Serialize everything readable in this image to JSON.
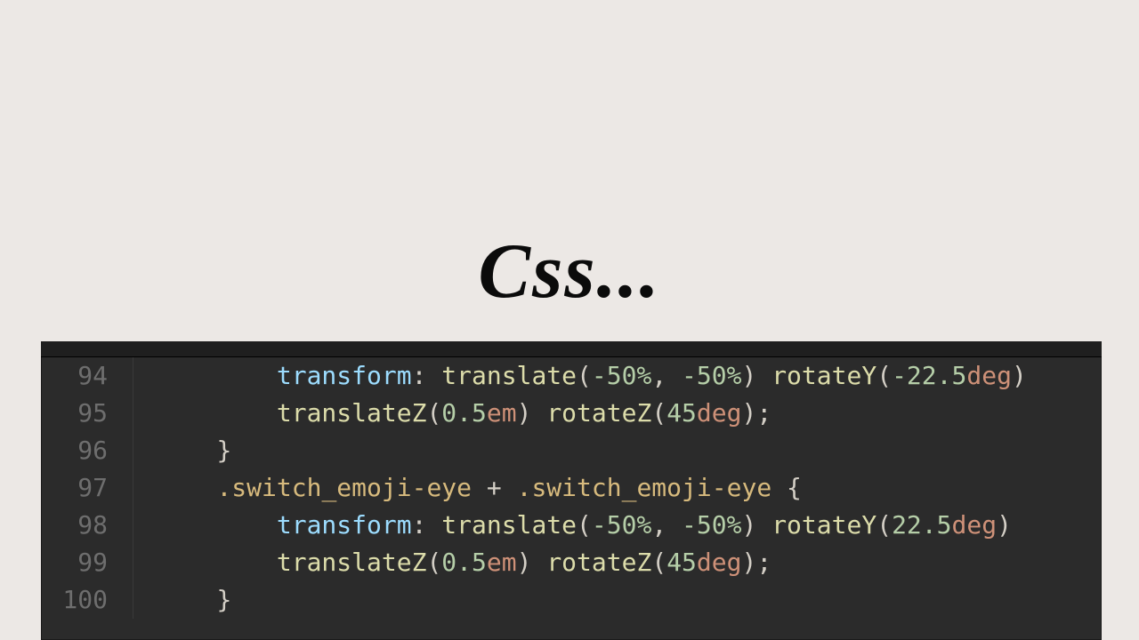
{
  "title": "Css...",
  "editor": {
    "startLine": 94,
    "lines": [
      {
        "n": 94,
        "indent": 2,
        "tokens": [
          {
            "t": "transform",
            "c": "tok-prop"
          },
          {
            "t": ": ",
            "c": "tok-punc"
          },
          {
            "t": "translate",
            "c": "tok-func"
          },
          {
            "t": "(",
            "c": "tok-punc"
          },
          {
            "t": "-50%",
            "c": "tok-num"
          },
          {
            "t": ", ",
            "c": "tok-punc"
          },
          {
            "t": "-50%",
            "c": "tok-num"
          },
          {
            "t": ") ",
            "c": "tok-punc"
          },
          {
            "t": "rotateY",
            "c": "tok-func"
          },
          {
            "t": "(",
            "c": "tok-punc"
          },
          {
            "t": "-22.5",
            "c": "tok-num"
          },
          {
            "t": "deg",
            "c": "tok-deg"
          },
          {
            "t": ")",
            "c": "tok-punc"
          }
        ]
      },
      {
        "n": 95,
        "indent": 2,
        "tokens": [
          {
            "t": "translateZ",
            "c": "tok-func"
          },
          {
            "t": "(",
            "c": "tok-punc"
          },
          {
            "t": "0.5",
            "c": "tok-num"
          },
          {
            "t": "em",
            "c": "tok-deg"
          },
          {
            "t": ") ",
            "c": "tok-punc"
          },
          {
            "t": "rotateZ",
            "c": "tok-func"
          },
          {
            "t": "(",
            "c": "tok-punc"
          },
          {
            "t": "45",
            "c": "tok-num"
          },
          {
            "t": "deg",
            "c": "tok-deg"
          },
          {
            "t": ")",
            "c": "tok-punc"
          },
          {
            "t": ";",
            "c": "tok-punc"
          }
        ]
      },
      {
        "n": 96,
        "indent": 1,
        "tokens": [
          {
            "t": "}",
            "c": "tok-brace"
          }
        ]
      },
      {
        "n": 97,
        "indent": 1,
        "tokens": [
          {
            "t": ".switch_emoji-eye",
            "c": "tok-sel"
          },
          {
            "t": " + ",
            "c": "tok-op"
          },
          {
            "t": ".switch_emoji-eye",
            "c": "tok-sel"
          },
          {
            "t": " {",
            "c": "tok-brace"
          }
        ]
      },
      {
        "n": 98,
        "indent": 2,
        "tokens": [
          {
            "t": "transform",
            "c": "tok-prop"
          },
          {
            "t": ": ",
            "c": "tok-punc"
          },
          {
            "t": "translate",
            "c": "tok-func"
          },
          {
            "t": "(",
            "c": "tok-punc"
          },
          {
            "t": "-50%",
            "c": "tok-num"
          },
          {
            "t": ", ",
            "c": "tok-punc"
          },
          {
            "t": "-50%",
            "c": "tok-num"
          },
          {
            "t": ") ",
            "c": "tok-punc"
          },
          {
            "t": "rotateY",
            "c": "tok-func"
          },
          {
            "t": "(",
            "c": "tok-punc"
          },
          {
            "t": "22.5",
            "c": "tok-num"
          },
          {
            "t": "deg",
            "c": "tok-deg"
          },
          {
            "t": ")",
            "c": "tok-punc"
          }
        ]
      },
      {
        "n": 99,
        "indent": 2,
        "tokens": [
          {
            "t": "translateZ",
            "c": "tok-func"
          },
          {
            "t": "(",
            "c": "tok-punc"
          },
          {
            "t": "0.5",
            "c": "tok-num"
          },
          {
            "t": "em",
            "c": "tok-deg"
          },
          {
            "t": ") ",
            "c": "tok-punc"
          },
          {
            "t": "rotateZ",
            "c": "tok-func"
          },
          {
            "t": "(",
            "c": "tok-punc"
          },
          {
            "t": "45",
            "c": "tok-num"
          },
          {
            "t": "deg",
            "c": "tok-deg"
          },
          {
            "t": ")",
            "c": "tok-punc"
          },
          {
            "t": ";",
            "c": "tok-punc"
          }
        ]
      },
      {
        "n": 100,
        "indent": 1,
        "tokens": [
          {
            "t": "}",
            "c": "tok-brace"
          }
        ]
      }
    ]
  }
}
